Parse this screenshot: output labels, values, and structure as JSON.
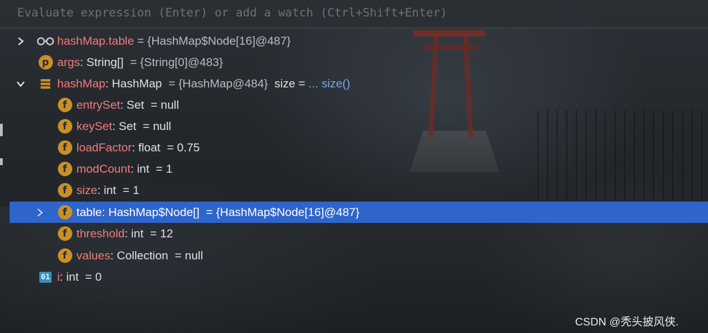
{
  "expression_bar": {
    "placeholder": "Evaluate expression (Enter) or add a watch (Ctrl+Shift+Enter)"
  },
  "variables": [
    {
      "name": "hashMap.table",
      "type": "",
      "separator": " = ",
      "value": "{HashMap$Node[16]@487}",
      "expanded": false,
      "icon": "watch-glasses-icon",
      "selected": false
    },
    {
      "name": "args",
      "type": ": String[]",
      "separator": "  = ",
      "value": "{String[0]@483}",
      "icon": "parameter-icon",
      "icon_letter": "p",
      "selected": false
    },
    {
      "name": "hashMap",
      "type": ": HashMap",
      "separator": "  = ",
      "value": "{HashMap@484}",
      "extra_label": "  size = ",
      "extra_link": "... size()",
      "expanded": true,
      "icon": "object-icon",
      "selected": false
    },
    {
      "name": "entrySet",
      "type": ": Set",
      "separator": "  = ",
      "value": "null",
      "icon": "field-icon",
      "icon_letter": "f",
      "selected": false
    },
    {
      "name": "keySet",
      "type": ": Set",
      "separator": "  = ",
      "value": "null",
      "icon": "field-icon",
      "icon_letter": "f",
      "selected": false
    },
    {
      "name": "loadFactor",
      "type": ": float",
      "separator": "  = ",
      "value": "0.75",
      "icon": "field-icon",
      "icon_letter": "f",
      "selected": false
    },
    {
      "name": "modCount",
      "type": ": int",
      "separator": "  = ",
      "value": "1",
      "icon": "field-icon",
      "icon_letter": "f",
      "selected": false
    },
    {
      "name": "size",
      "type": ": int",
      "separator": "  = ",
      "value": "1",
      "icon": "field-icon",
      "icon_letter": "f",
      "selected": false
    },
    {
      "name": "table",
      "type": ": HashMap$Node[]",
      "separator": "  = ",
      "value": "{HashMap$Node[16]@487}",
      "expanded": false,
      "icon": "field-icon",
      "icon_letter": "f",
      "selected": true
    },
    {
      "name": "threshold",
      "type": ": int",
      "separator": "  = ",
      "value": "12",
      "icon": "field-icon",
      "icon_letter": "f",
      "selected": false
    },
    {
      "name": "values",
      "type": ": Collection",
      "separator": "  = ",
      "value": "null",
      "icon": "field-icon",
      "icon_letter": "f",
      "selected": false
    },
    {
      "name": "i",
      "type": ": int",
      "separator": "  = ",
      "value": "0",
      "icon": "local-variable-icon",
      "icon_letter": "01",
      "selected": false
    }
  ],
  "watermark": "CSDN @秃头披风侠.",
  "colors": {
    "selection": "#2f65ca",
    "field_name": "#f47a7a",
    "field_icon": "#c98f28",
    "link": "#7ea6ee",
    "local_icon": "#3b8fb8"
  }
}
